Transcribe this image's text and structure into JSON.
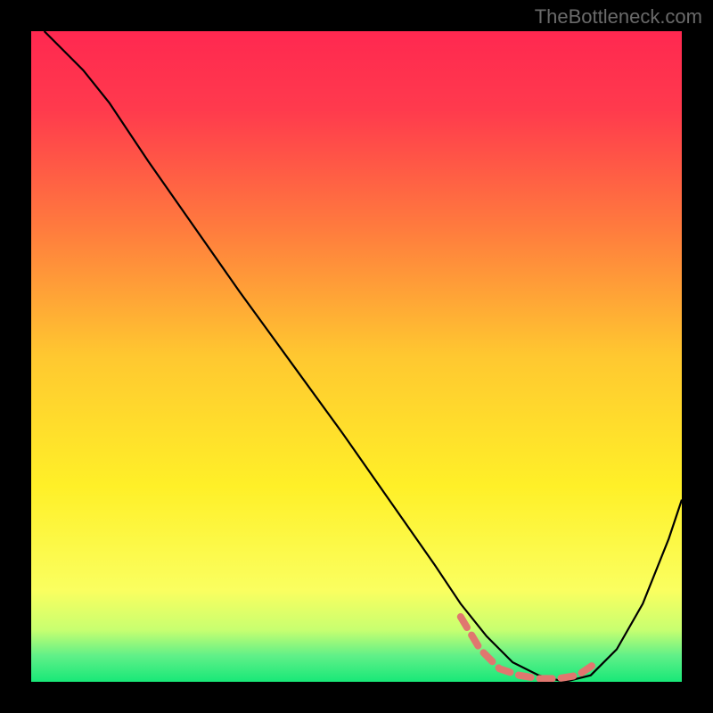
{
  "watermark": "TheBottleneck.com",
  "chart_data": {
    "type": "line",
    "title": "",
    "xlabel": "",
    "ylabel": "",
    "xlim": [
      0,
      100
    ],
    "ylim": [
      0,
      100
    ],
    "series": [
      {
        "name": "bottleneck-curve",
        "color": "#000000",
        "x": [
          2,
          5,
          8,
          12,
          18,
          25,
          32,
          40,
          48,
          55,
          62,
          66,
          70,
          74,
          78,
          82,
          86,
          90,
          94,
          98,
          100
        ],
        "y": [
          100,
          97,
          94,
          89,
          80,
          70,
          60,
          49,
          38,
          28,
          18,
          12,
          7,
          3,
          1,
          0,
          1,
          5,
          12,
          22,
          28
        ]
      },
      {
        "name": "optimal-range",
        "color": "#e0776f",
        "style": "dashed-thick",
        "x": [
          66,
          69,
          72,
          75,
          78,
          81,
          84,
          87
        ],
        "y": [
          10,
          5,
          2,
          1,
          0.5,
          0.5,
          1,
          3
        ]
      }
    ],
    "background_gradient": {
      "stops": [
        {
          "offset": 0.0,
          "color": "#ff2850"
        },
        {
          "offset": 0.12,
          "color": "#ff3a4d"
        },
        {
          "offset": 0.3,
          "color": "#ff7a3e"
        },
        {
          "offset": 0.5,
          "color": "#ffc830"
        },
        {
          "offset": 0.7,
          "color": "#fff028"
        },
        {
          "offset": 0.86,
          "color": "#faff60"
        },
        {
          "offset": 0.92,
          "color": "#c8ff70"
        },
        {
          "offset": 0.96,
          "color": "#60f088"
        },
        {
          "offset": 1.0,
          "color": "#18e878"
        }
      ]
    }
  }
}
